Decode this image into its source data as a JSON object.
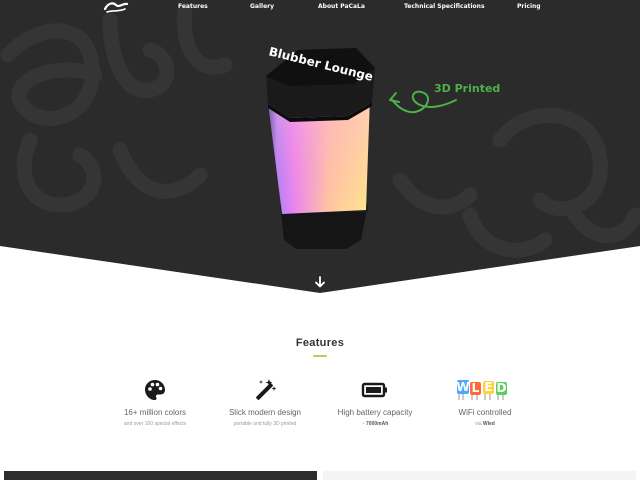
{
  "nav": {
    "brand": "Blubber Lounge",
    "links": [
      "Features",
      "Gallery",
      "About PaCaLa",
      "Technical Specifications",
      "Pricing"
    ]
  },
  "hero": {
    "lamp_text": "Blubber Lounge",
    "annotation": "3D Printed",
    "background_color": "#2b2b2b",
    "watermark_color": "#353535",
    "accent_color": "#4db04a"
  },
  "features": {
    "title": "Features",
    "underline_color": "#a8d65a",
    "items": [
      {
        "icon": "palette-icon",
        "title": "16+ million colors",
        "subtitle": "and over 100 special effects",
        "subtitle_strong": ""
      },
      {
        "icon": "magic-wand-icon",
        "title": "Slick modern design",
        "subtitle": "portable and fully 3D printed",
        "subtitle_strong": ""
      },
      {
        "icon": "battery-icon",
        "title": "High battery capacity",
        "subtitle": "~ ",
        "subtitle_strong": "7000mAh"
      },
      {
        "icon": "wled-logo-icon",
        "title": "WiFi controlled",
        "subtitle": "via ",
        "subtitle_strong": "Wled"
      }
    ],
    "wled_letters": "WLED"
  }
}
